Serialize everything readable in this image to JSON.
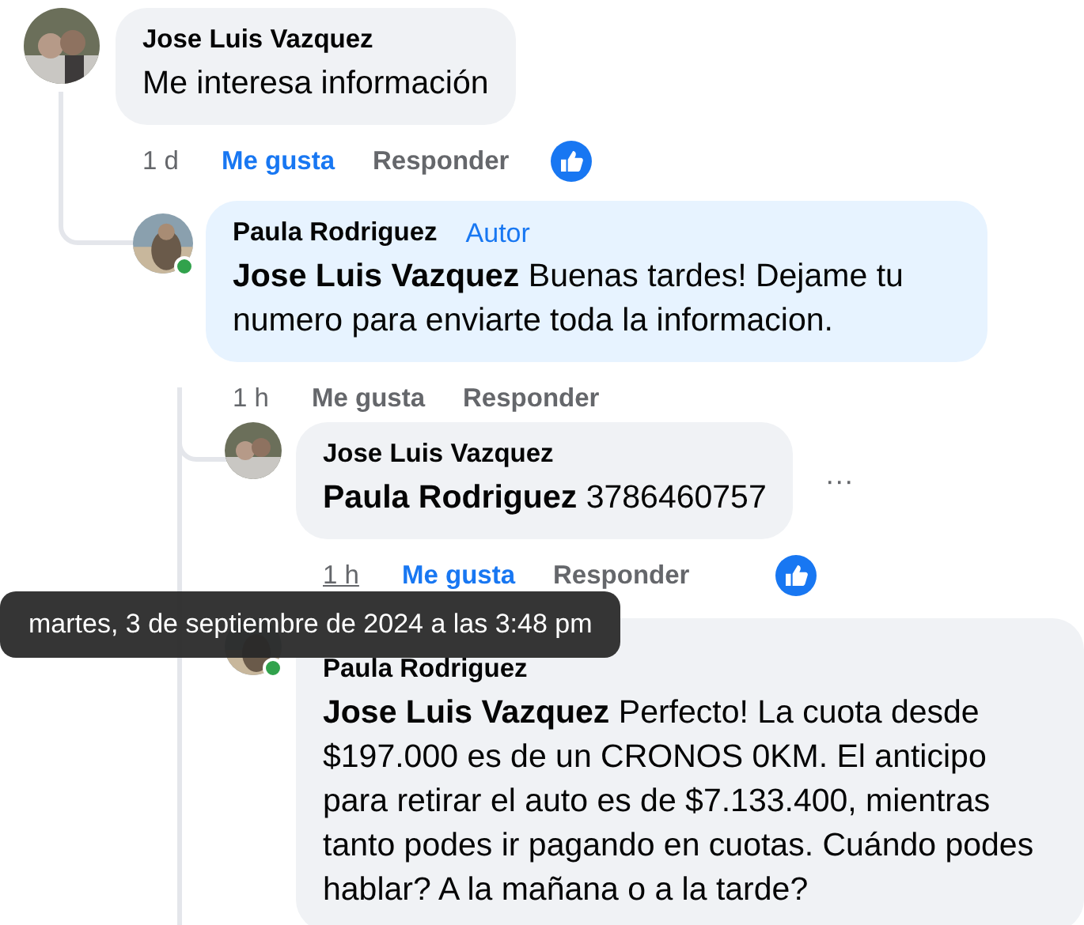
{
  "comments": [
    {
      "author": "Jose Luis Vazquez",
      "text": "Me interesa información",
      "time": "1 d",
      "like_label": "Me gusta",
      "reply_label": "Responder",
      "liked": true,
      "reaction": true,
      "children": [
        {
          "author": "Paula Rodriguez",
          "badge": "Autor",
          "mention": "Jose Luis Vazquez",
          "text": "Buenas tardes! Dejame tu numero para enviarte toda la informacion.",
          "time": "1 h",
          "like_label": "Me gusta",
          "reply_label": "Responder",
          "liked": false,
          "online": true,
          "highlight": true,
          "children": [
            {
              "author": "Jose Luis Vazquez",
              "mention": "Paula Rodriguez",
              "text": "3786460757",
              "time": "1 h",
              "like_label": "Me gusta",
              "reply_label": "Responder",
              "liked": true,
              "reaction": true,
              "more": "···",
              "time_hover": true
            },
            {
              "author": "Paula Rodriguez",
              "mention": "Jose Luis Vazquez",
              "text": "Perfecto! La cuota desde $197.000 es de un CRONOS 0KM. El anticipo para retirar el auto es de $7.133.400, mientras tanto podes ir pagando en cuotas. Cuándo podes hablar? A la mañana o a la tarde?",
              "online": true
            }
          ]
        }
      ]
    }
  ],
  "tooltip": "martes, 3 de septiembre de 2024 a las 3:48 pm"
}
